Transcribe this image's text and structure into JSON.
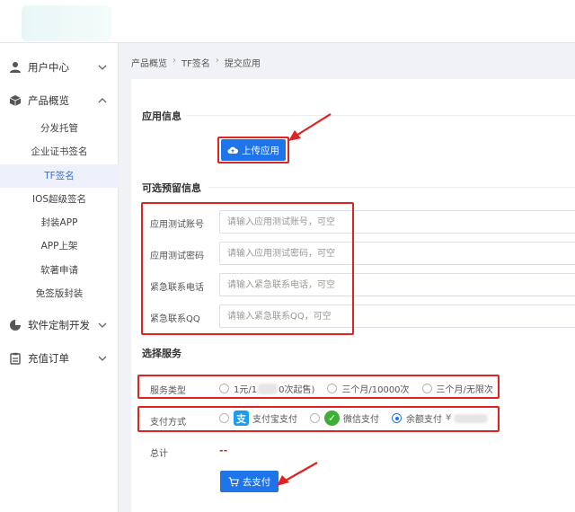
{
  "sidebar": {
    "items": [
      {
        "label": "用户中心",
        "icon": "user-icon"
      },
      {
        "label": "产品概览",
        "icon": "cube-icon"
      },
      {
        "label": "软件定制开发",
        "icon": "pie-chart-icon"
      },
      {
        "label": "充值订单",
        "icon": "clipboard-icon"
      }
    ],
    "sub_items": [
      "分发托管",
      "企业证书签名",
      "TF签名",
      "IOS超级签名",
      "封装APP",
      "APP上架",
      "软著申请",
      "免签版封装"
    ],
    "active_sub": "TF签名"
  },
  "breadcrumb": [
    "产品概览",
    "TF签名",
    "提交应用"
  ],
  "breadcrumb_sep": "›",
  "sections": {
    "app_info": "应用信息",
    "optional": "可选预留信息",
    "service": "选择服务"
  },
  "upload_button": "上传应用",
  "fields": [
    {
      "label": "应用测试账号",
      "placeholder": "请输入应用测试账号，可空"
    },
    {
      "label": "应用测试密码",
      "placeholder": "请输入应用测试密码，可空"
    },
    {
      "label": "紧急联系电话",
      "placeholder": "请输入紧急联系电话，可空"
    },
    {
      "label": "紧急联系QQ",
      "placeholder": "请输入紧急联系QQ，可空"
    }
  ],
  "service_type": {
    "label": "服务类型",
    "options": [
      {
        "prefix": "1元/1",
        "suffix": "0次起售)"
      },
      {
        "label": "三个月/10000次"
      },
      {
        "label": "三个月/无限次"
      }
    ]
  },
  "payment": {
    "label": "支付方式",
    "options": [
      {
        "label": "支付宝支付",
        "icon": "alipay-icon",
        "icon_glyph": "支"
      },
      {
        "label": "微信支付",
        "icon": "wechat-icon",
        "icon_glyph": "✓"
      },
      {
        "label": "余额支付",
        "suffix": "¥"
      }
    ],
    "selected": "余额支付"
  },
  "total": {
    "label": "总计",
    "value": "--"
  },
  "pay_button": "去支付",
  "colors": {
    "primary": "#1e74e8",
    "annotation": "#e02222",
    "active_bg": "#eef1fb"
  }
}
